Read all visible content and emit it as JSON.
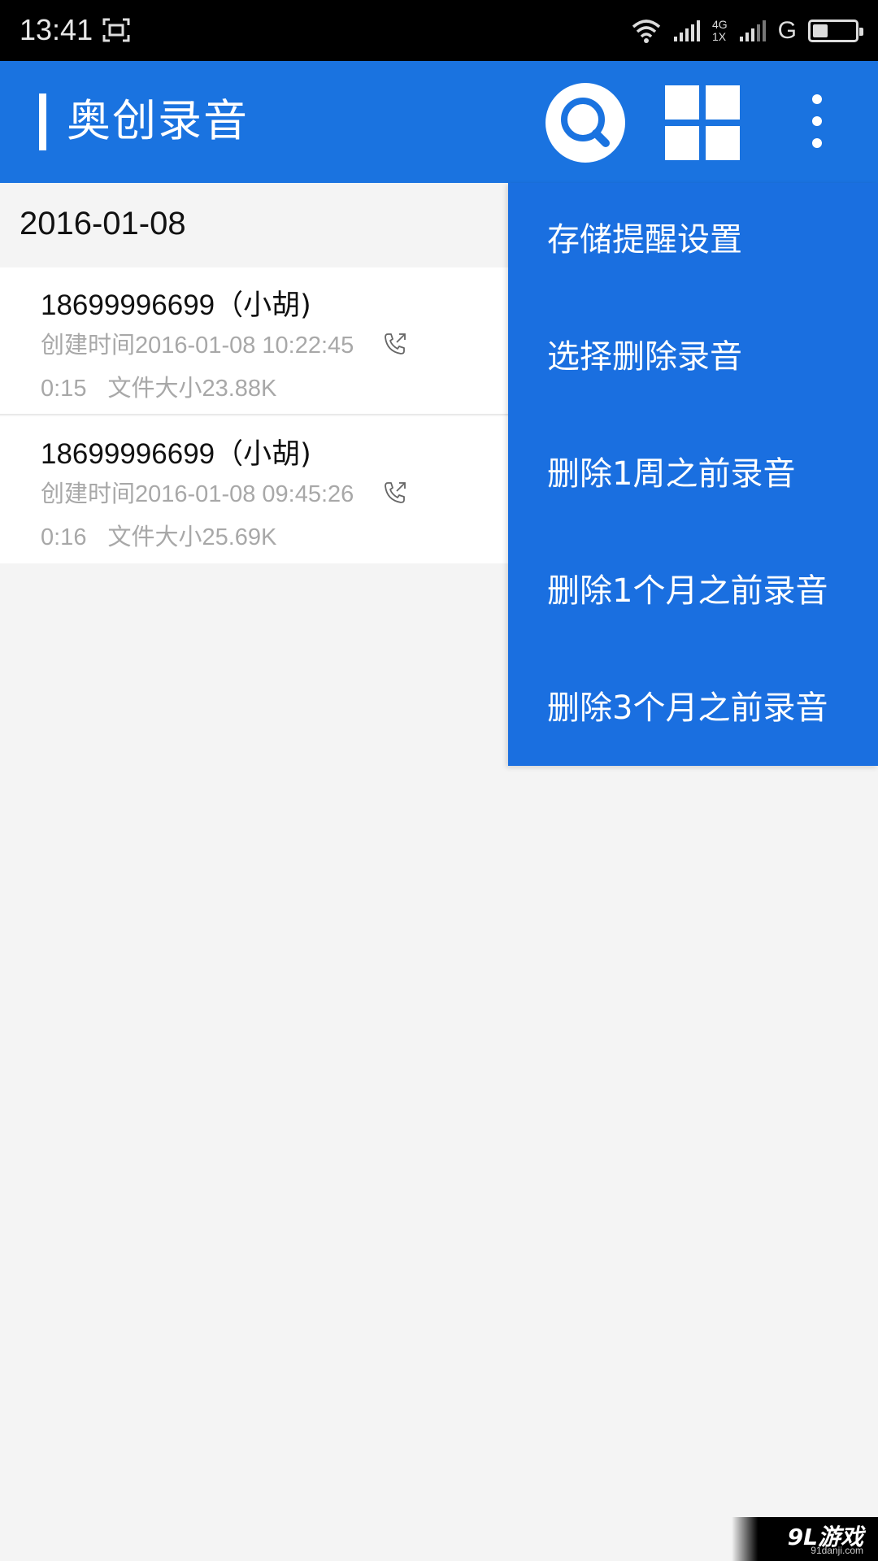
{
  "status_bar": {
    "time": "13:41",
    "network_top": "4G",
    "network_bottom": "1X",
    "signal2_label": "G",
    "battery_level": 0.35,
    "icons": [
      "screenshot-icon",
      "wifi-icon",
      "signal-icon",
      "signal-icon",
      "battery-icon"
    ]
  },
  "app_bar": {
    "title": "奥创录音",
    "accent_color": "#1a73e0",
    "actions": [
      "search-icon",
      "grid-icon",
      "more-vert-icon"
    ]
  },
  "list": {
    "date_header": "2016-01-08",
    "recordings": [
      {
        "number": "18699996699",
        "contact": "（小胡)",
        "created_label": "创建时间",
        "created_time": "2016-01-08 10:22:45",
        "duration": "0:15",
        "size_label": "文件大小",
        "size": "23.88K",
        "call_icon": "outgoing-call-icon"
      },
      {
        "number": "18699996699",
        "contact": "（小胡)",
        "created_label": "创建时间",
        "created_time": "2016-01-08 09:45:26",
        "duration": "0:16",
        "size_label": "文件大小",
        "size": "25.69K",
        "call_icon": "outgoing-call-icon"
      }
    ]
  },
  "menu": {
    "items": [
      "存储提醒设置",
      "选择删除录音",
      "删除1周之前录音",
      "删除1个月之前录音",
      "删除3个月之前录音"
    ],
    "background_color": "#1a6fe0"
  },
  "watermark": {
    "logo": "9L游戏",
    "url": "91danji.com"
  }
}
